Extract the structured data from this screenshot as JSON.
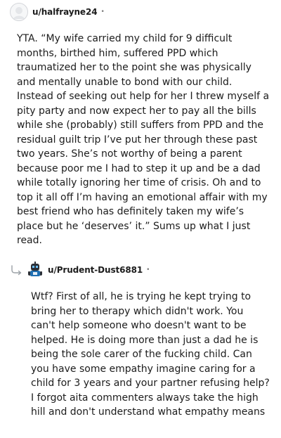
{
  "comments": [
    {
      "author": "u/halfrayne24",
      "separator": "•",
      "avatar_icon": "default-avatar-icon",
      "body": "YTA. “My wife carried my child for 9 difficult months, birthed him, suffered PPD which traumatized her to the point she was physically and mentally unable to bond with our child. Instead of seeking out help for her I threw myself a pity party and now expect her to pay all the bills while she (probably) still suffers from PPD and the residual guilt trip I’ve put her through these past two years. She’s not worthy of being a parent because poor me I had to step it up and be a dad while totally ignoring her time of crisis. Oh and to top it all off I’m having an emotional affair with my best friend who has definitely taken my wife’s place but he ‘deserves’ it.” Sums up what I just read."
    },
    {
      "author": "u/Prudent-Dust6881",
      "separator": "•",
      "avatar_icon": "robot-avatar-icon",
      "reply_icon": "reply-arrow-icon",
      "body": "Wtf? First of all, he is trying he kept trying to bring her to therapy which didn't work. You can't help someone who doesn't want to be helped. He is doing more than just a dad he is being the sole carer of the fucking child. Can you have some empathy imagine caring for a child for 3 years and your partner refusing help? I forgot aita commenters always take the high hill and don't understand what empathy means"
    }
  ],
  "colors": {
    "text": "#1c1c1c",
    "muted": "#7c7c7c",
    "avatar_border": "#d4d6da",
    "robot_blue": "#1f6fb2"
  }
}
